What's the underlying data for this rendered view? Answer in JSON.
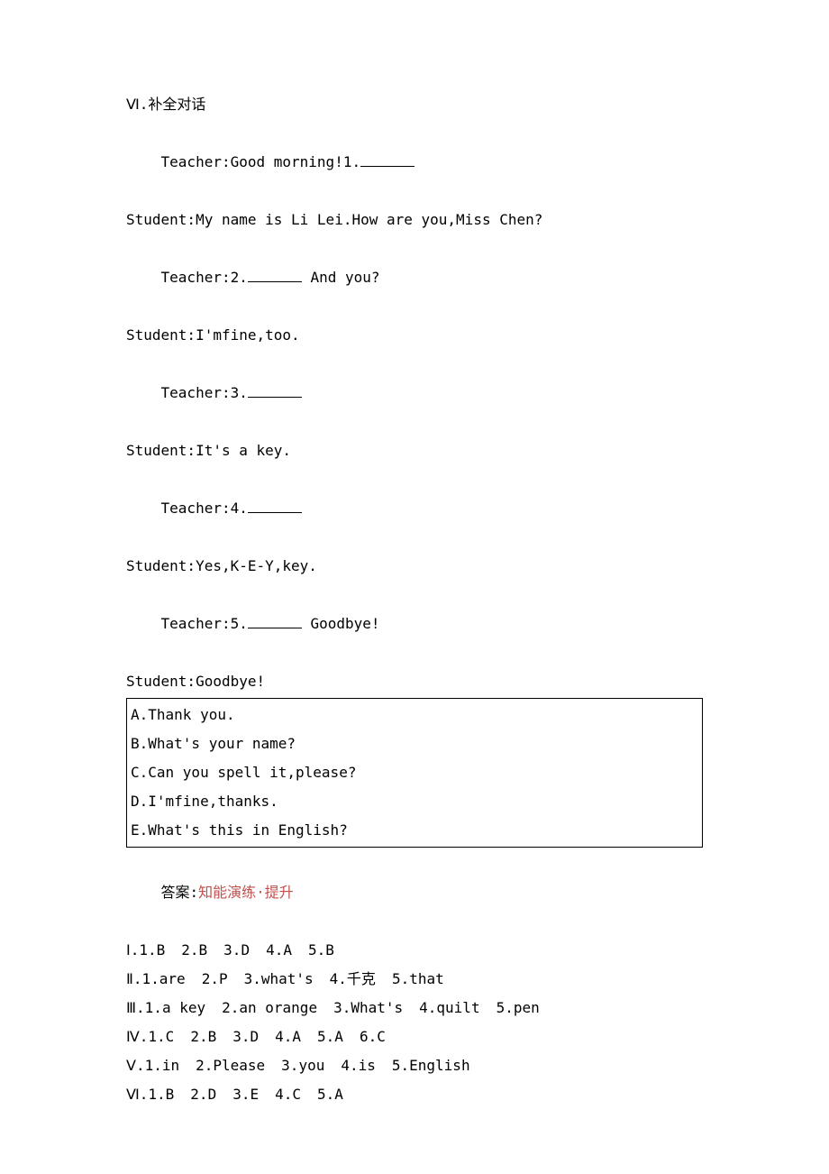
{
  "section6": {
    "heading": "Ⅵ.补全对话",
    "dialogue": {
      "l1_pre": "Teacher:Good morning!1.",
      "l2": "Student:My name is Li Lei.How are you,Miss Chen?",
      "l3_pre": "Teacher:2.",
      "l3_post": " And you?",
      "l4": "Student:I'mfine,too.",
      "l5_pre": "Teacher:3.",
      "l6": "Student:It's a key.",
      "l7_pre": "Teacher:4.",
      "l8": "Student:Yes,K-E-Y,key.",
      "l9_pre": "Teacher:5.",
      "l9_post": " Goodbye!",
      "l10": "Student:Goodbye!"
    },
    "options": {
      "a": "A.Thank you.",
      "b": "B.What's your name?",
      "c": "C.Can you spell it,please?",
      "d": "D.I'mfine,thanks.",
      "e": "E.What's this in English?"
    }
  },
  "answers": {
    "label_prefix": "答案:",
    "label_red": "知能演练·提升",
    "r1": {
      "h": "Ⅰ.",
      "a1": "1.B",
      "a2": "2.B",
      "a3": "3.D",
      "a4": "4.A",
      "a5": "5.B"
    },
    "r2": {
      "h": "Ⅱ.",
      "a1": "1.are",
      "a2": "2.P",
      "a3": "3.what's",
      "a4": "4.千克",
      "a5": "5.that"
    },
    "r3": {
      "h": "Ⅲ.",
      "a1": "1.a key",
      "a2": "2.an orange",
      "a3": "3.What's",
      "a4": "4.quilt",
      "a5": "5.pen"
    },
    "r4": {
      "h": "Ⅳ.",
      "a1": "1.C",
      "a2": "2.B",
      "a3": "3.D",
      "a4": "4.A",
      "a5": "5.A",
      "a6": "6.C"
    },
    "r5": {
      "h": "Ⅴ.",
      "a1": "1.in",
      "a2": "2.Please",
      "a3": "3.you",
      "a4": "4.is",
      "a5": "5.English"
    },
    "r6": {
      "h": "Ⅵ.",
      "a1": "1.B",
      "a2": "2.D",
      "a3": "3.E",
      "a4": "4.C",
      "a5": "5.A"
    }
  }
}
